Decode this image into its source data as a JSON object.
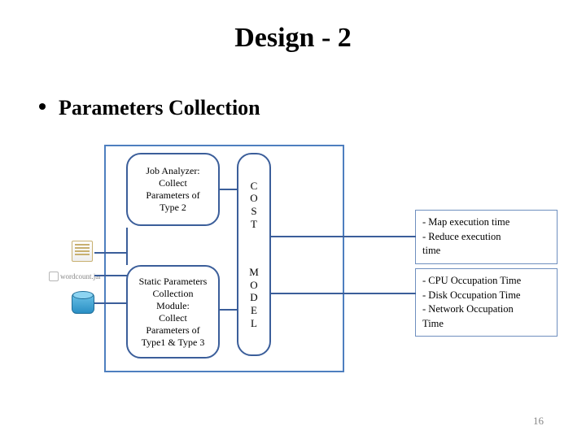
{
  "title": "Design - 2",
  "bullet": "Parameters Collection",
  "jar_label": "wordcount.jar",
  "nodes": {
    "job_analyzer": "Job Analyzer:\nCollect\nParameters of\nType 2",
    "static_collector": "Static Parameters\nCollection\nModule:\nCollect\nParameters of\nType1 & Type 3",
    "cost_top": "C\nO\nS\nT",
    "cost_bot": "M\nO\nD\nE\nL"
  },
  "outputs": {
    "exec": "- Map execution time\n- Reduce execution\ntime",
    "occ": "- CPU Occupation Time\n- Disk Occupation Time\n- Network Occupation\nTime"
  },
  "page": "16"
}
